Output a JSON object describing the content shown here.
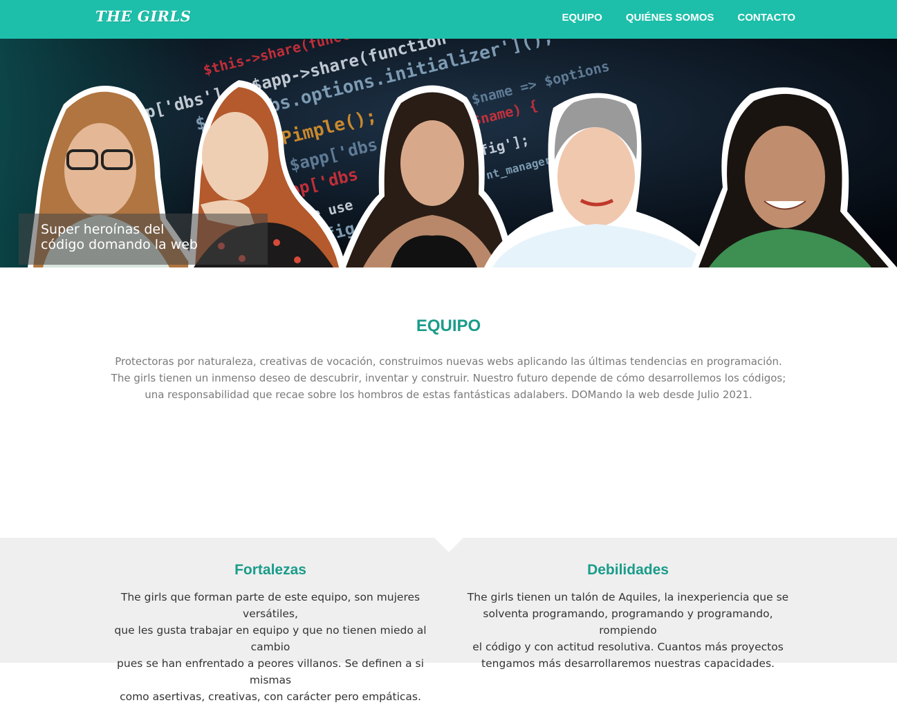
{
  "header": {
    "logo": "THE GIRLS",
    "nav": [
      {
        "label": "EQUIPO"
      },
      {
        "label": "QUIÉNES SOMOS"
      },
      {
        "label": "CONTACTO"
      }
    ]
  },
  "hero": {
    "caption": "Super heroínas del\ncódigo domando la web",
    "code_lines": [
      "$this->share(function ($app",
      "$app['dbs'] = $app->share(function",
      "$app['dbs.options.initializer']();",
      "\\Pimple();",
      "new $app['dbs.o",
      "$app['dbs",
      "we use",
      "config",
      "manager",
      "as $name => $options",
      "$name) {",
      "fig'];",
      "nt_manager"
    ]
  },
  "equipo": {
    "title": "EQUIPO",
    "lines": [
      "Protectoras por naturaleza, creativas de vocación, construimos nuevas webs aplicando las últimas tendencias en programación.",
      "The girls tienen un inmenso deseo de descubrir, inventar y construir. Nuestro futuro depende de cómo desarrollemos los códigos;",
      "una responsabilidad que recae sobre los hombros de estas fantásticas adalabers. DOMando la web desde Julio 2021."
    ]
  },
  "fortalezas": {
    "title": "Fortalezas",
    "lines": [
      "The girls que forman parte de este equipo, son mujeres versátiles,",
      "que les gusta trabajar en equipo y que no tienen miedo al cambio",
      "pues se han enfrentado a peores villanos. Se definen a si mismas",
      "como asertivas, creativas, con carácter pero empáticas."
    ]
  },
  "debilidades": {
    "title": "Debilidades",
    "lines": [
      "The girls tienen un talón de Aquiles, la inexperiencia que se",
      "solventa programando, programando y programando, rompiendo",
      "el código y con actitud resolutiva. Cuantos más proyectos",
      "tengamos más desarrollaremos nuestras capacidades."
    ]
  },
  "colors": {
    "accent": "#1dbfaa",
    "heading": "#1a9c8a"
  }
}
